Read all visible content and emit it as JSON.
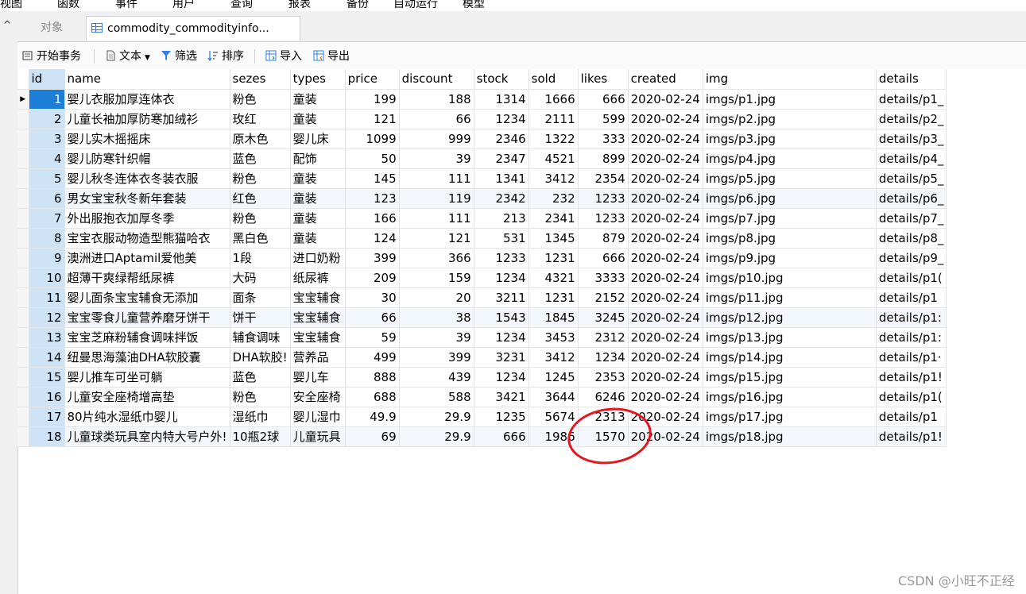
{
  "menu": [
    "视图",
    "函数",
    "事件",
    "用户",
    "查询",
    "报表",
    "备份",
    "自动运行",
    "模型"
  ],
  "tabs": {
    "objects": "对象",
    "table": "commodity_commodityinfo..."
  },
  "toolbar": {
    "begin_transaction": "开始事务",
    "text": "文本",
    "filter": "筛选",
    "sort": "排序",
    "import": "导入",
    "export": "导出"
  },
  "columns": [
    "id",
    "name",
    "sezes",
    "types",
    "price",
    "discount",
    "stock",
    "sold",
    "likes",
    "created",
    "img",
    "details"
  ],
  "rows": [
    [
      "1",
      "婴儿衣服加厚连体衣",
      "粉色",
      "童装",
      "199",
      "188",
      "1314",
      "1666",
      "666",
      "2020-02-24",
      "imgs/p1.jpg",
      "details/p1_"
    ],
    [
      "2",
      "儿童长袖加厚防寒加绒衫",
      "玫红",
      "童装",
      "121",
      "66",
      "1234",
      "2111",
      "599",
      "2020-02-24",
      "imgs/p2.jpg",
      "details/p2_"
    ],
    [
      "3",
      "婴儿实木摇摇床",
      "原木色",
      "婴儿床",
      "1099",
      "999",
      "2346",
      "1322",
      "333",
      "2020-02-24",
      "imgs/p3.jpg",
      "details/p3_"
    ],
    [
      "4",
      "婴儿防寒针织帽",
      "蓝色",
      "配饰",
      "50",
      "39",
      "2347",
      "4521",
      "899",
      "2020-02-24",
      "imgs/p4.jpg",
      "details/p4_"
    ],
    [
      "5",
      "婴儿秋冬连体衣冬装衣服",
      "粉色",
      "童装",
      "145",
      "111",
      "1341",
      "3412",
      "2354",
      "2020-02-24",
      "imgs/p5.jpg",
      "details/p5_"
    ],
    [
      "6",
      "男女宝宝秋冬新年套装",
      "红色",
      "童装",
      "123",
      "119",
      "2342",
      "232",
      "1233",
      "2020-02-24",
      "imgs/p6.jpg",
      "details/p6_"
    ],
    [
      "7",
      "外出服抱衣加厚冬季",
      "粉色",
      "童装",
      "166",
      "111",
      "213",
      "2341",
      "1233",
      "2020-02-24",
      "imgs/p7.jpg",
      "details/p7_"
    ],
    [
      "8",
      "宝宝衣服动物造型熊猫哈衣",
      "黑白色",
      "童装",
      "124",
      "121",
      "531",
      "1345",
      "879",
      "2020-02-24",
      "imgs/p8.jpg",
      "details/p8_"
    ],
    [
      "9",
      "澳洲进口Aptamil爱他美",
      "1段",
      "进口奶粉",
      "399",
      "366",
      "1233",
      "1231",
      "666",
      "2020-02-24",
      "imgs/p9.jpg",
      "details/p9_"
    ],
    [
      "10",
      "超薄干爽绿帮纸尿裤",
      "大码",
      "纸尿裤",
      "209",
      "159",
      "1234",
      "4321",
      "3333",
      "2020-02-24",
      "imgs/p10.jpg",
      "details/p1("
    ],
    [
      "11",
      "婴儿面条宝宝辅食无添加",
      "面条",
      "宝宝辅食",
      "30",
      "20",
      "3211",
      "1231",
      "2152",
      "2020-02-24",
      "imgs/p11.jpg",
      "details/p1"
    ],
    [
      "12",
      "宝宝零食儿童营养磨牙饼干",
      "饼干",
      "宝宝辅食",
      "66",
      "38",
      "1543",
      "1845",
      "3245",
      "2020-02-24",
      "imgs/p12.jpg",
      "details/p1:"
    ],
    [
      "13",
      "宝宝芝麻粉辅食调味拌饭",
      "辅食调味",
      "宝宝辅食",
      "59",
      "39",
      "1234",
      "3453",
      "2312",
      "2020-02-24",
      "imgs/p13.jpg",
      "details/p1:"
    ],
    [
      "14",
      "纽曼思海藻油DHA软胶囊",
      "DHA软胶!",
      "营养品",
      "499",
      "399",
      "3231",
      "3412",
      "1234",
      "2020-02-24",
      "imgs/p14.jpg",
      "details/p1·"
    ],
    [
      "15",
      "婴儿推车可坐可躺",
      "蓝色",
      "婴儿车",
      "888",
      "439",
      "1234",
      "1245",
      "2353",
      "2020-02-24",
      "imgs/p15.jpg",
      "details/p1!"
    ],
    [
      "16",
      "儿童安全座椅增高垫",
      "粉色",
      "安全座椅",
      "688",
      "588",
      "3421",
      "3644",
      "6246",
      "2020-02-24",
      "imgs/p16.jpg",
      "details/p1("
    ],
    [
      "17",
      "80片纯水湿纸巾婴儿",
      "湿纸巾",
      "婴儿湿巾",
      "49.9",
      "29.9",
      "1235",
      "5674",
      "2313",
      "2020-02-24",
      "imgs/p17.jpg",
      "details/p1"
    ],
    [
      "18",
      "儿童球类玩具室内特大号户外!",
      "10瓶2球",
      "儿童玩具",
      "69",
      "29.9",
      "666",
      "1986",
      "1570",
      "2020-02-24",
      "imgs/p18.jpg",
      "details/p1!"
    ]
  ],
  "watermark": "CSDN @小旺不正经",
  "colors": {
    "selected_header": "#cfe3f7",
    "current_row_id": "#1c7ed6",
    "annotation_circle": "#e8141c"
  }
}
